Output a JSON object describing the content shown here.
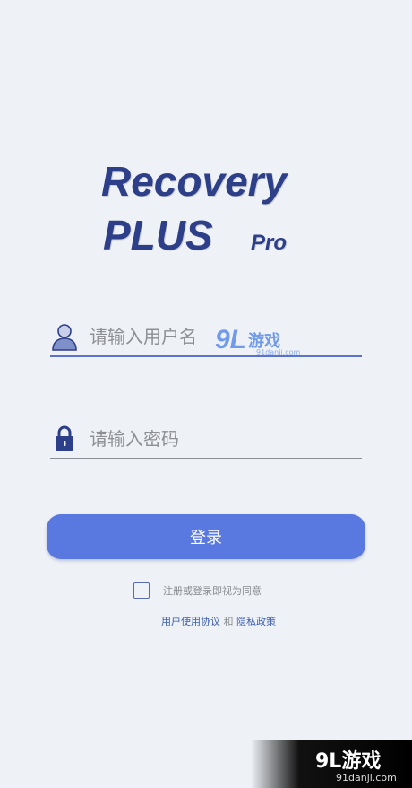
{
  "logo": {
    "line1": "Recovery",
    "line2": "PLUS",
    "suffix": "Pro"
  },
  "username": {
    "placeholder": "请输入用户名",
    "value": ""
  },
  "password": {
    "placeholder": "请输入密码",
    "value": ""
  },
  "login": {
    "label": "登录"
  },
  "agreement": {
    "text": "注册或登录即视为同意",
    "user_agreement": "用户使用协议",
    "and": "和",
    "privacy_policy": "隐私政策"
  },
  "watermark": {
    "num": "9L",
    "text": "游戏",
    "site": "91danji.com"
  },
  "corner_watermark": {
    "logo": "9L游戏",
    "site": "91danji.com"
  },
  "colors": {
    "background": "#eef1f6",
    "brand": "#2e3f8a",
    "button": "#5a79e0",
    "link": "#3d5fb0"
  }
}
